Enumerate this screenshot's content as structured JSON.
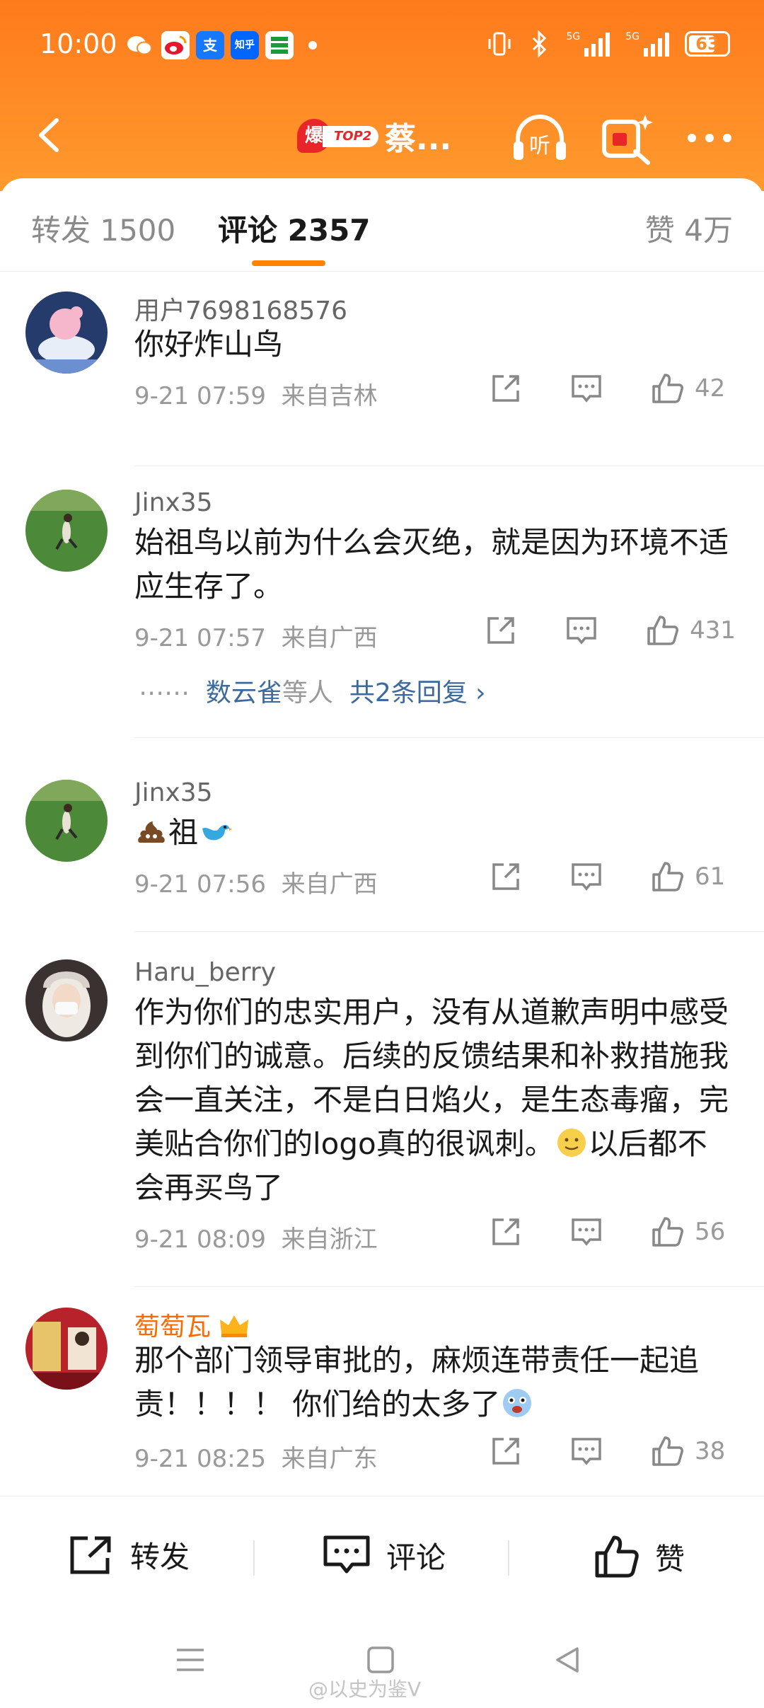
{
  "status_bar": {
    "time": "10:00",
    "notif_icons": [
      "wechat-icon",
      "weibo-icon",
      "alipay-icon",
      "zhihu-icon",
      "bank-icon"
    ],
    "zhihu_label": "知乎",
    "alipay_label": "支",
    "network_1": "5G",
    "network_2": "5G",
    "battery": "63"
  },
  "header": {
    "hot_badge_icon": "爆",
    "hot_rank": "TOP2",
    "title": "蔡..."
  },
  "tabs": {
    "repost": "转发 1500",
    "comments": "评论 2357",
    "likes": "赞 4万"
  },
  "comments": [
    {
      "user": "用户7698168576",
      "text": "你好炸山鸟",
      "time": "9-21 07:59",
      "location": "来自吉林",
      "likes": "42"
    },
    {
      "user": "Jinx35",
      "text": "始祖鸟以前为什么会灭绝，就是因为环境不适应生存了。",
      "time": "9-21 07:57",
      "location": "来自广西",
      "likes": "431",
      "reply_names": "数云雀",
      "reply_mid": "等人",
      "reply_count": "共2条回复"
    },
    {
      "user": "Jinx35",
      "text": "祖",
      "time": "9-21 07:56",
      "location": "来自广西",
      "likes": "61"
    },
    {
      "user": "Haru_berry",
      "text_a": "作为你们的忠实用户，没有从道歉声明中感受到你们的诚意。后续的反馈结果和补救措施我会一直关注，不是白日焰火，是生态毒瘤，完美贴合你们的logo真的很讽刺。",
      "text_b": "以后都不会再买鸟了",
      "time": "9-21 08:09",
      "location": "来自浙江",
      "likes": "56"
    },
    {
      "user": "萄萄瓦",
      "text": "那个部门领导审批的，麻烦连带责任一起追责！！！！ 你们给的太多了",
      "time": "9-21 08:25",
      "location": "来自广东",
      "likes": "38"
    }
  ],
  "bottom_bar": {
    "repost": "转发",
    "comment": "评论",
    "like": "赞"
  },
  "watermark": "@以史为鉴V",
  "colors": {
    "header": "#ff8a26",
    "accent": "#ff8200",
    "link": "#3d6a9e",
    "vip": "#ff6a00"
  }
}
